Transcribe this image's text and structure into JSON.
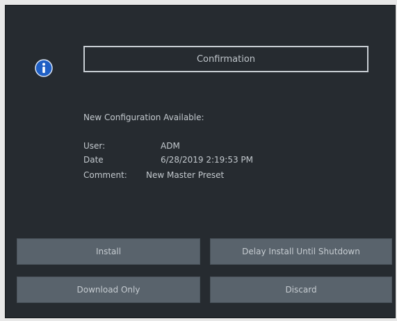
{
  "dialog": {
    "title": "Confirmation",
    "message": "New Configuration Available:",
    "details": {
      "user_label": "User:",
      "user_value": "ADM",
      "date_label": "Date",
      "date_value": "6/28/2019 2:19:53 PM",
      "comment_label": "Comment:",
      "comment_value": "New Master Preset"
    },
    "icon": "info-icon",
    "accent_color": "#1f5fc4"
  },
  "buttons": {
    "install": "Install",
    "delay_install": "Delay Install Until Shutdown",
    "download_only": "Download Only",
    "discard": "Discard"
  }
}
